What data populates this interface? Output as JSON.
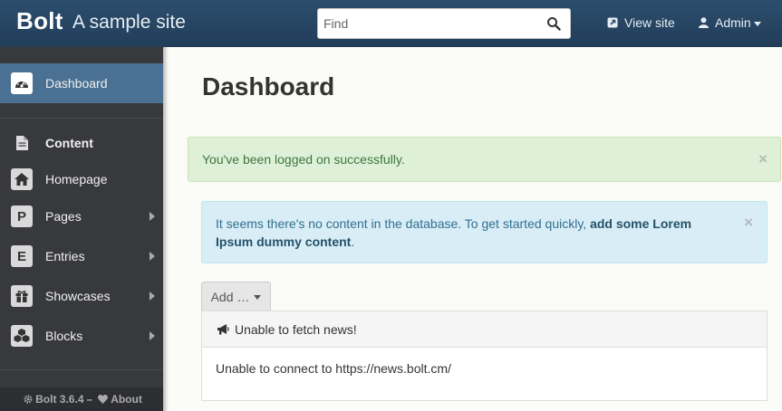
{
  "header": {
    "brand": "Bolt",
    "site_name": "A sample site",
    "search_placeholder": "Find",
    "view_site": "View site",
    "user": "Admin"
  },
  "sidebar": {
    "items": [
      {
        "label": "Dashboard",
        "icon": "dashboard-icon",
        "active": true
      },
      {
        "label": "Content",
        "icon": "document-icon",
        "heading": true
      },
      {
        "label": "Homepage",
        "icon": "home-icon"
      },
      {
        "label": "Pages",
        "icon_letter": "P",
        "has_submenu": true
      },
      {
        "label": "Entries",
        "icon_letter": "E",
        "has_submenu": true
      },
      {
        "label": "Showcases",
        "icon": "gift-icon",
        "has_submenu": true
      },
      {
        "label": "Blocks",
        "icon": "cubes-icon",
        "has_submenu": true
      }
    ],
    "footer": {
      "version": "Bolt 3.6.4",
      "separator": "–",
      "about": "About"
    }
  },
  "main": {
    "title": "Dashboard",
    "success_alert": "You've been logged on successfully.",
    "info_alert": {
      "text": "It seems there's no content in the database. To get started quickly,",
      "link": "add some Lorem Ipsum dummy content",
      "suffix": "."
    },
    "close_glyph": "×",
    "add_button": "Add …",
    "news_panel": {
      "heading": "Unable to fetch news!",
      "body": "Unable to connect to https://news.bolt.cm/"
    }
  },
  "colors": {
    "topbar": "#2c4e6e",
    "sidebar": "#38393d",
    "sidebar_active": "#4a7193",
    "success_bg": "#dff0d8",
    "info_bg": "#d9edf7"
  }
}
